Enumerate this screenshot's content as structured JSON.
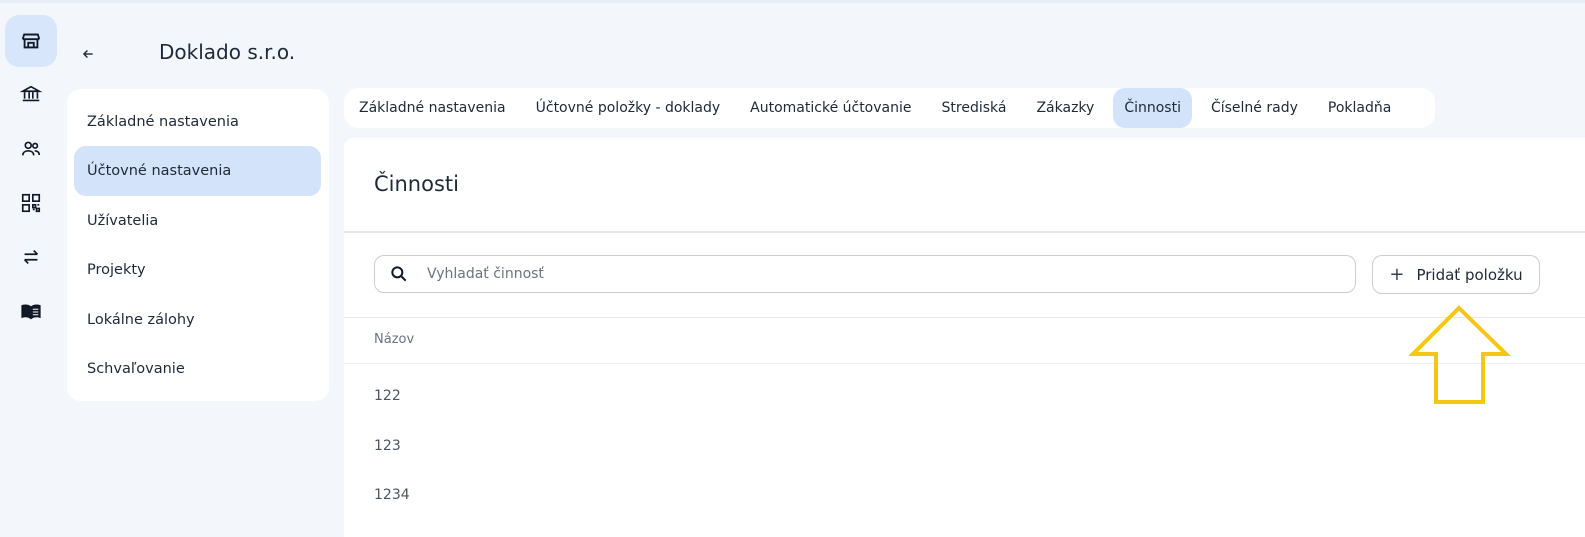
{
  "header": {
    "company": "Doklado s.r.o."
  },
  "rail": {
    "items": [
      {
        "icon": "store-icon",
        "active": true
      },
      {
        "icon": "bank-icon",
        "active": false
      },
      {
        "icon": "users-icon",
        "active": false
      },
      {
        "icon": "qr-code-icon",
        "active": false
      },
      {
        "icon": "transfer-icon",
        "active": false
      },
      {
        "icon": "book-icon",
        "active": false
      }
    ]
  },
  "menu": {
    "items": [
      {
        "label": "Základné nastavenia",
        "active": false
      },
      {
        "label": "Účtovné nastavenia",
        "active": true
      },
      {
        "label": "Užívatelia",
        "active": false
      },
      {
        "label": "Projekty",
        "active": false
      },
      {
        "label": "Lokálne zálohy",
        "active": false
      },
      {
        "label": "Schvaľovanie",
        "active": false
      }
    ]
  },
  "tabs": [
    {
      "label": "Základné nastavenia",
      "active": false
    },
    {
      "label": "Účtovné položky - doklady",
      "active": false
    },
    {
      "label": "Automatické účtovanie",
      "active": false
    },
    {
      "label": "Strediská",
      "active": false
    },
    {
      "label": "Zákazky",
      "active": false
    },
    {
      "label": "Činnosti",
      "active": true
    },
    {
      "label": "Číselné rady",
      "active": false
    },
    {
      "label": "Pokladňa",
      "active": false
    }
  ],
  "main": {
    "title": "Činnosti",
    "search": {
      "placeholder": "Vyhladať činnosť",
      "value": ""
    },
    "add_button": "Pridať položku",
    "add_icon": "+",
    "table": {
      "columns": [
        "Názov"
      ],
      "rows": [
        "122",
        "123",
        "1234"
      ]
    }
  },
  "colors": {
    "accent": "#d3e3fa",
    "background": "#f3f7fc",
    "annotation": "#f5c518"
  }
}
